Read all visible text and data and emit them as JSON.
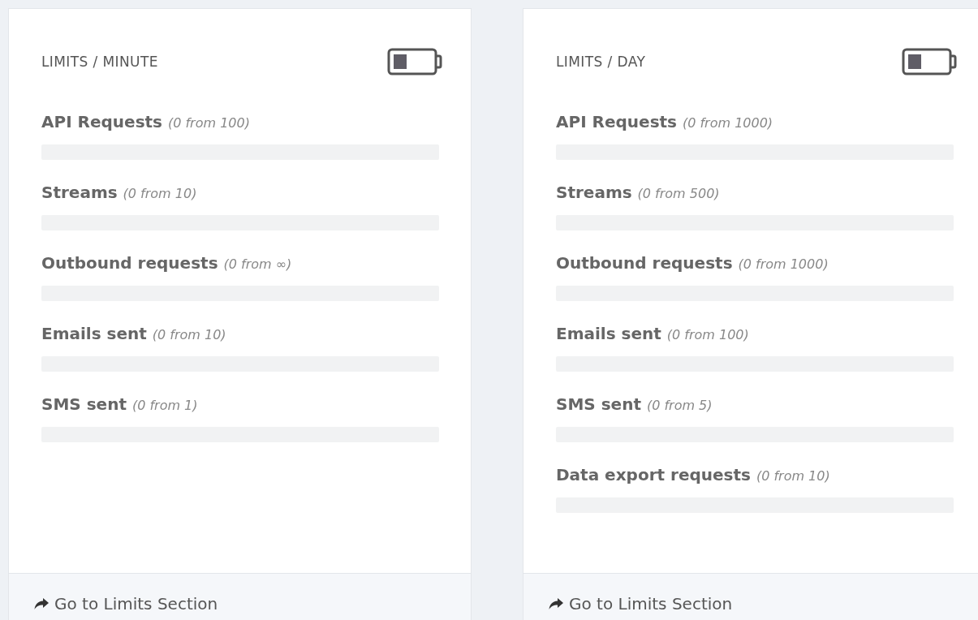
{
  "cards": [
    {
      "title": "LIMITS / MINUTE",
      "rows": [
        {
          "label": "API Requests",
          "note": "(0 from 100)",
          "level": 0
        },
        {
          "label": "Streams",
          "note": "(0 from 10)",
          "level": 0
        },
        {
          "label": "Outbound requests",
          "note": "(0 from ∞)",
          "level": 0
        },
        {
          "label": "Emails sent",
          "note": "(0 from 10)",
          "level": 0
        },
        {
          "label": "SMS sent",
          "note": "(0 from 1)",
          "level": 0
        }
      ],
      "footer_link": "Go to Limits Section"
    },
    {
      "title": "LIMITS / DAY",
      "rows": [
        {
          "label": "API Requests",
          "note": "(0 from 1000)",
          "level": 0
        },
        {
          "label": "Streams",
          "note": "(0 from 500)",
          "level": 0
        },
        {
          "label": "Outbound requests",
          "note": "(0 from 1000)",
          "level": 0
        },
        {
          "label": "Emails sent",
          "note": "(0 from 100)",
          "level": 0
        },
        {
          "label": "SMS sent",
          "note": "(0 from 5)",
          "level": 0
        },
        {
          "label": "Data export requests",
          "note": "(0 from 10)",
          "level": 0
        }
      ],
      "footer_link": "Go to Limits Section"
    }
  ]
}
